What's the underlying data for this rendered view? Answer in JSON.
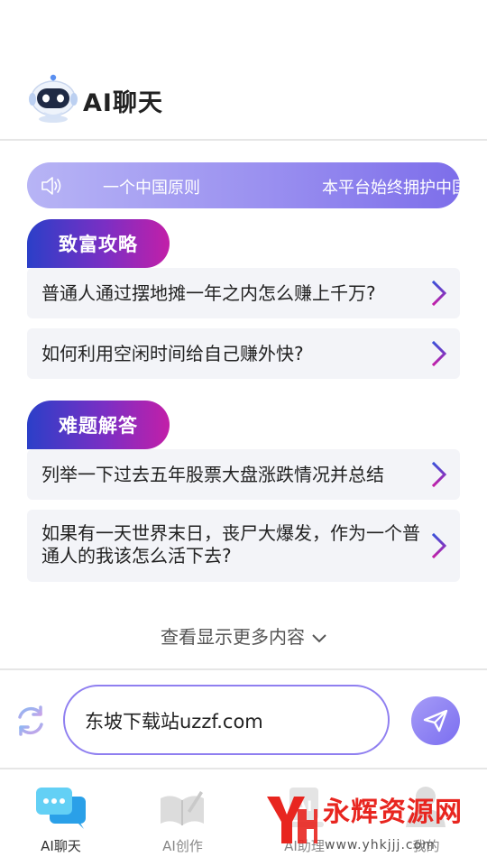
{
  "header": {
    "title": "AI聊天"
  },
  "notice": {
    "text_left": "一个中国原则",
    "text_right": "本平台始终拥护中国"
  },
  "sections": [
    {
      "title": "致富攻略",
      "items": [
        "普通人通过摆地摊一年之内怎么赚上千万?",
        "如何利用空闲时间给自己赚外快?"
      ]
    },
    {
      "title": "难题解答",
      "items": [
        "列举一下过去五年股票大盘涨跌情况并总结",
        "如果有一天世界末日，丧尸大爆发，作为一个普通人的我该怎么活下去?"
      ]
    }
  ],
  "more": {
    "label": "查看显示更多内容"
  },
  "composer": {
    "value": "东坡下载站uzzf.com"
  },
  "tabs": [
    {
      "label": "AI聊天",
      "icon": "chat-bubble-icon",
      "active": true
    },
    {
      "label": "AI创作",
      "icon": "book-icon",
      "active": false
    },
    {
      "label": "AI助理",
      "icon": "ai-box-icon",
      "active": false
    },
    {
      "label": "我的",
      "icon": "user-icon",
      "active": false
    }
  ],
  "watermark": {
    "name": "永辉资源网",
    "url": "www.yhkjjj.com"
  },
  "colors": {
    "accent": "#7b6ef0",
    "tag_start": "#2b3fc8",
    "tag_end": "#c21fa8",
    "watermark": "#e8251f"
  }
}
